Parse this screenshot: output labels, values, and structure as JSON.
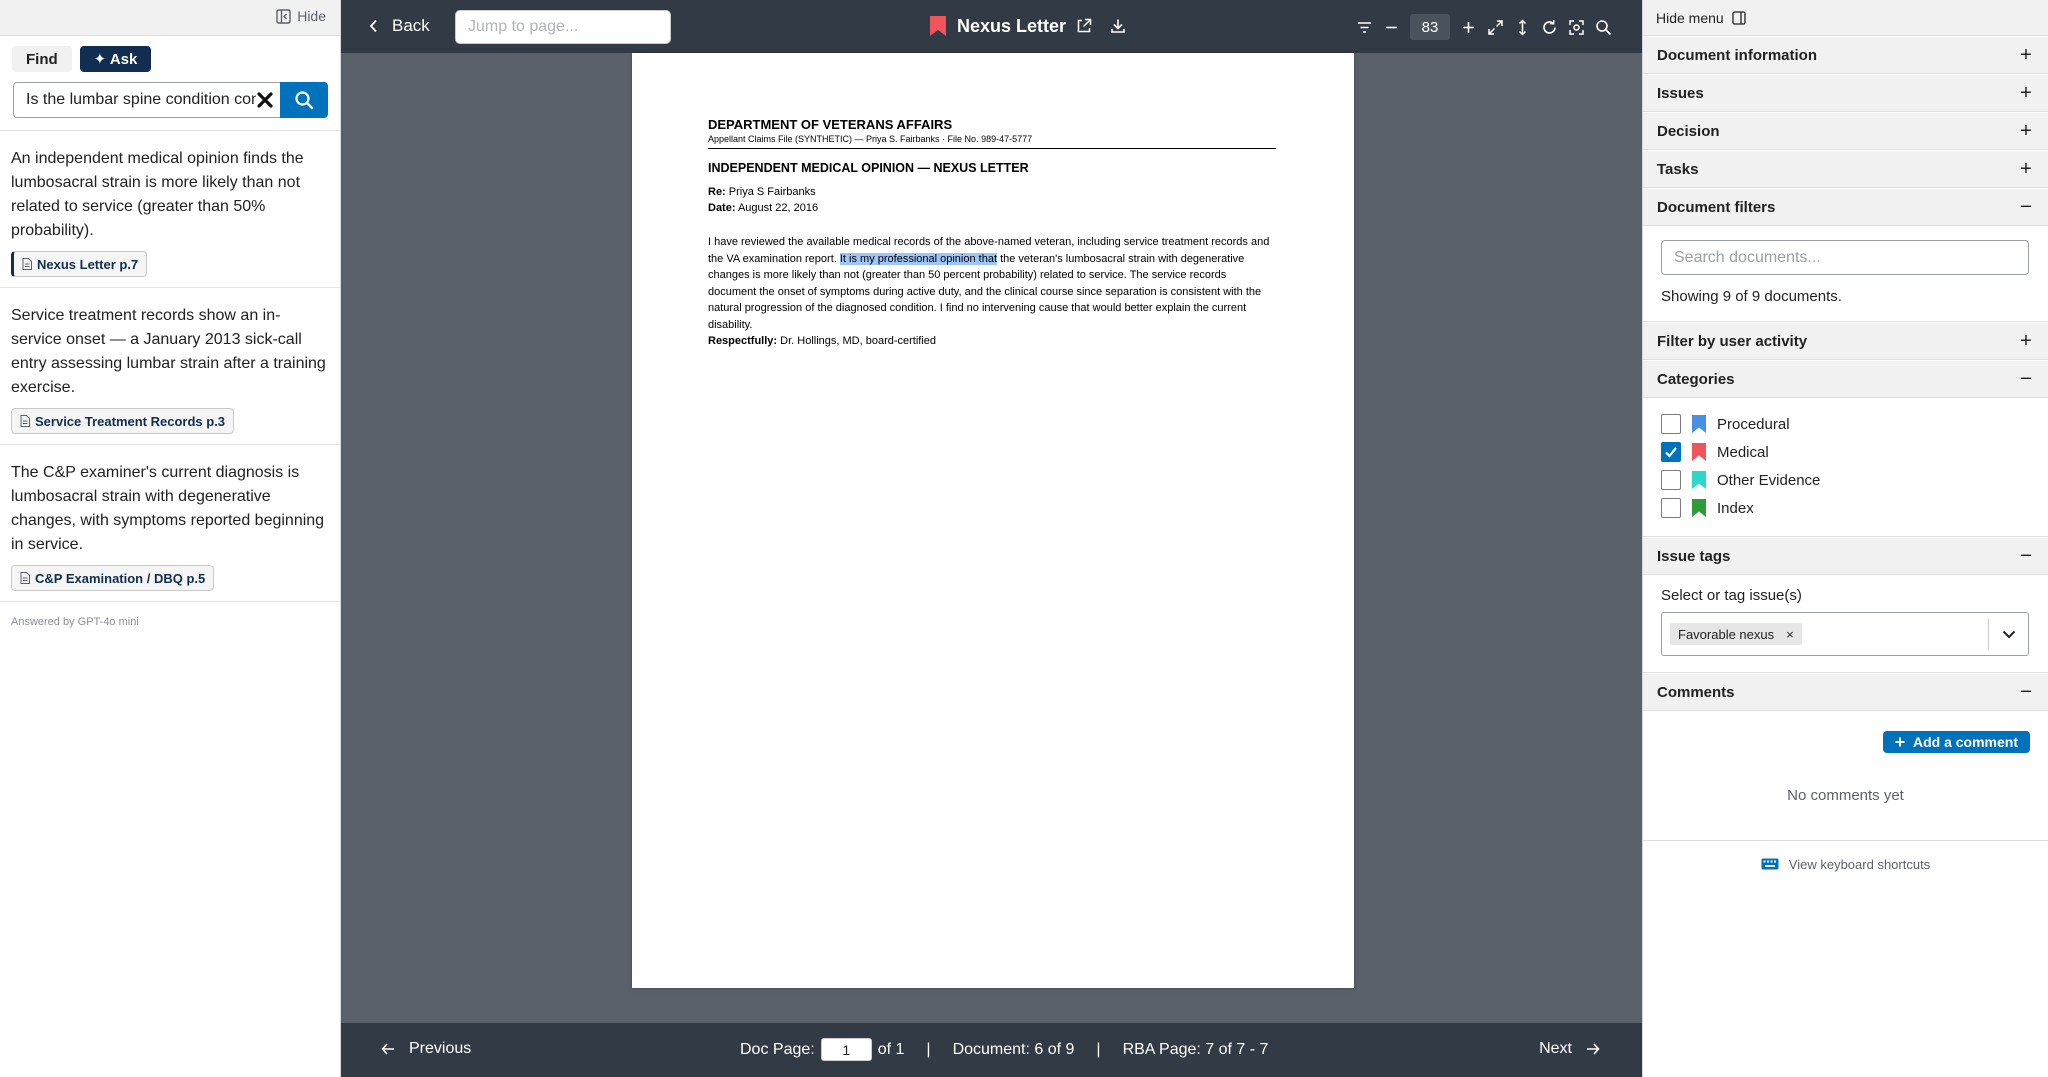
{
  "left_panel": {
    "hide_label": "Hide",
    "tabs": [
      {
        "label": "Find"
      },
      {
        "label": "✦ Ask"
      }
    ],
    "search_value": "Is the lumbar spine condition connected to service?",
    "answers": [
      {
        "text": "An independent medical opinion finds the lumbosacral strain is more likely than not related to service (greater than 50% probability).",
        "citation": "Nexus Letter p.7"
      },
      {
        "text": "Service treatment records show an in-service onset — a January 2013 sick-call entry assessing lumbar strain after a training exercise.",
        "citation": "Service Treatment Records p.3"
      },
      {
        "text": "The C&P examiner's current diagnosis is lumbosacral strain with degenerative changes, with symptoms reported beginning in service.",
        "citation": "C&P Examination / DBQ p.5"
      }
    ],
    "answered_by": "Answered by GPT-4o mini"
  },
  "topbar": {
    "back_label": "Back",
    "jump_placeholder": "Jump to page...",
    "doc_title": "Nexus Letter",
    "zoom": "83",
    "bookmark_color": "#f2545b"
  },
  "document": {
    "dept": "DEPARTMENT OF VETERANS AFFAIRS",
    "subhead": "Appellant Claims File (SYNTHETIC) — Priya S. Fairbanks  ·  File No. 989-47-5777",
    "title": "INDEPENDENT MEDICAL OPINION — NEXUS LETTER",
    "re_label": "Re:",
    "re_value": "Priya S Fairbanks",
    "date_label": "Date:",
    "date_value": "August 22, 2016",
    "body_before": "I have reviewed the available medical records of the above-named veteran, including service treatment records and the VA examination report. ",
    "body_highlight": "It is my professional opinion that",
    "body_after": " the veteran's lumbosacral strain with degenerative changes is more likely than not (greater than 50 percent probability) related to service. The service records document the onset of symptoms during active duty, and the clinical course since separation is consistent with the natural progression of the diagnosed condition. I find no intervening cause that would better explain the current disability.",
    "respect_label": "Respectfully:",
    "respect_value": "Dr. Hollings, MD, board-certified"
  },
  "bottombar": {
    "previous": "Previous",
    "next": "Next",
    "doc_page_label": "Doc Page:",
    "doc_page_value": "1",
    "doc_page_of": "of 1",
    "sep": "|",
    "document_label": "Document: 6 of 9",
    "rba_label": "RBA Page: 7 of 7 - 7"
  },
  "right_panel": {
    "hide_menu": "Hide menu",
    "sections": {
      "doc_info": "Document information",
      "issues": "Issues",
      "decision": "Decision",
      "tasks": "Tasks",
      "doc_filters": "Document filters",
      "user_activity": "Filter by user activity",
      "categories": "Categories",
      "issue_tags": "Issue tags",
      "comments": "Comments"
    },
    "plus": "+",
    "minus": "−",
    "search_placeholder": "Search documents...",
    "showing": "Showing 9 of 9 documents.",
    "categories": [
      {
        "label": "Procedural",
        "checked": false,
        "color": "#4a90e2"
      },
      {
        "label": "Medical",
        "checked": true,
        "color": "#f2545b"
      },
      {
        "label": "Other Evidence",
        "checked": false,
        "color": "#2ed8c6"
      },
      {
        "label": "Index",
        "checked": false,
        "color": "#2e9c3a"
      }
    ],
    "tag_label": "Select or tag issue(s)",
    "tag_chip": "Favorable nexus",
    "chip_remove": "×",
    "add_comment": "Add a comment",
    "no_comments": "No comments yet",
    "shortcuts": "View keyboard shortcuts"
  }
}
